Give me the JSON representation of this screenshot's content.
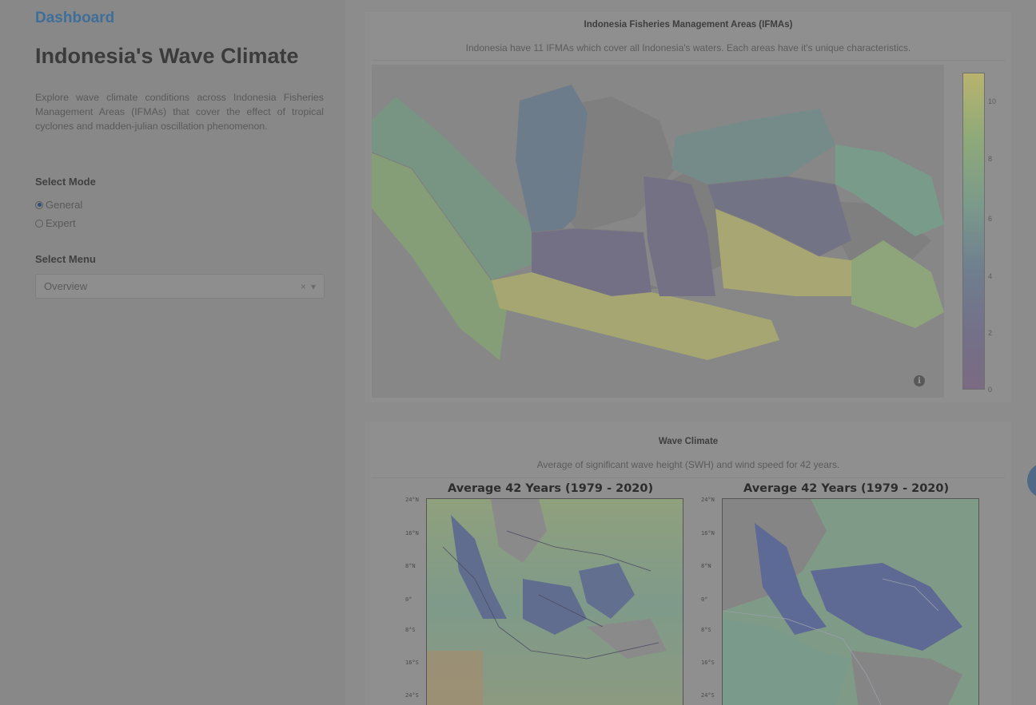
{
  "sidebar": {
    "brand": "Dashboard",
    "title": "Indonesia's Wave Climate",
    "intro": "Explore wave climate conditions across Indonesia Fisheries Management Areas (IFMAs) that cover the effect of tropical cyclones and madden-julian oscillation phenomenon.",
    "mode_label": "Select Mode",
    "modes": [
      {
        "label": "General",
        "selected": true
      },
      {
        "label": "Expert",
        "selected": false
      }
    ],
    "menu_label": "Select Menu",
    "menu_value": "Overview",
    "menu_clear": "×",
    "menu_arrow": "▾"
  },
  "ifma_panel": {
    "title": "Indonesia Fisheries Management Areas (IFMAs)",
    "subtitle": "Indonesia have 11 IFMAs which cover all Indonesia's waters. Each areas have it's unique characteristics.",
    "info_glyph": "i",
    "colorbar_ticks": [
      "10",
      "8",
      "6",
      "4",
      "2",
      "0"
    ],
    "colorbar_range": [
      0,
      11
    ],
    "colors": {
      "high": "#b9b36e",
      "mid": "#7a9a8b",
      "low": "#7a6b82"
    }
  },
  "wave_panel": {
    "title": "Wave Climate",
    "subtitle": "Average of significant wave height (SWH) and wind speed for 42 years.",
    "plots": [
      {
        "title": "Average 42 Years (1979 - 2020)",
        "variable": "swh"
      },
      {
        "title": "Average 42 Years (1979 - 2020)",
        "variable": "wind"
      }
    ],
    "lat_ticks": [
      "24°N",
      "16°N",
      "8°N",
      "0°",
      "8°S",
      "16°S",
      "24°S"
    ]
  },
  "icons": {
    "info": "info-icon",
    "clear": "clear-icon",
    "dropdown": "chevron-down-icon",
    "float": "floating-action-button"
  }
}
